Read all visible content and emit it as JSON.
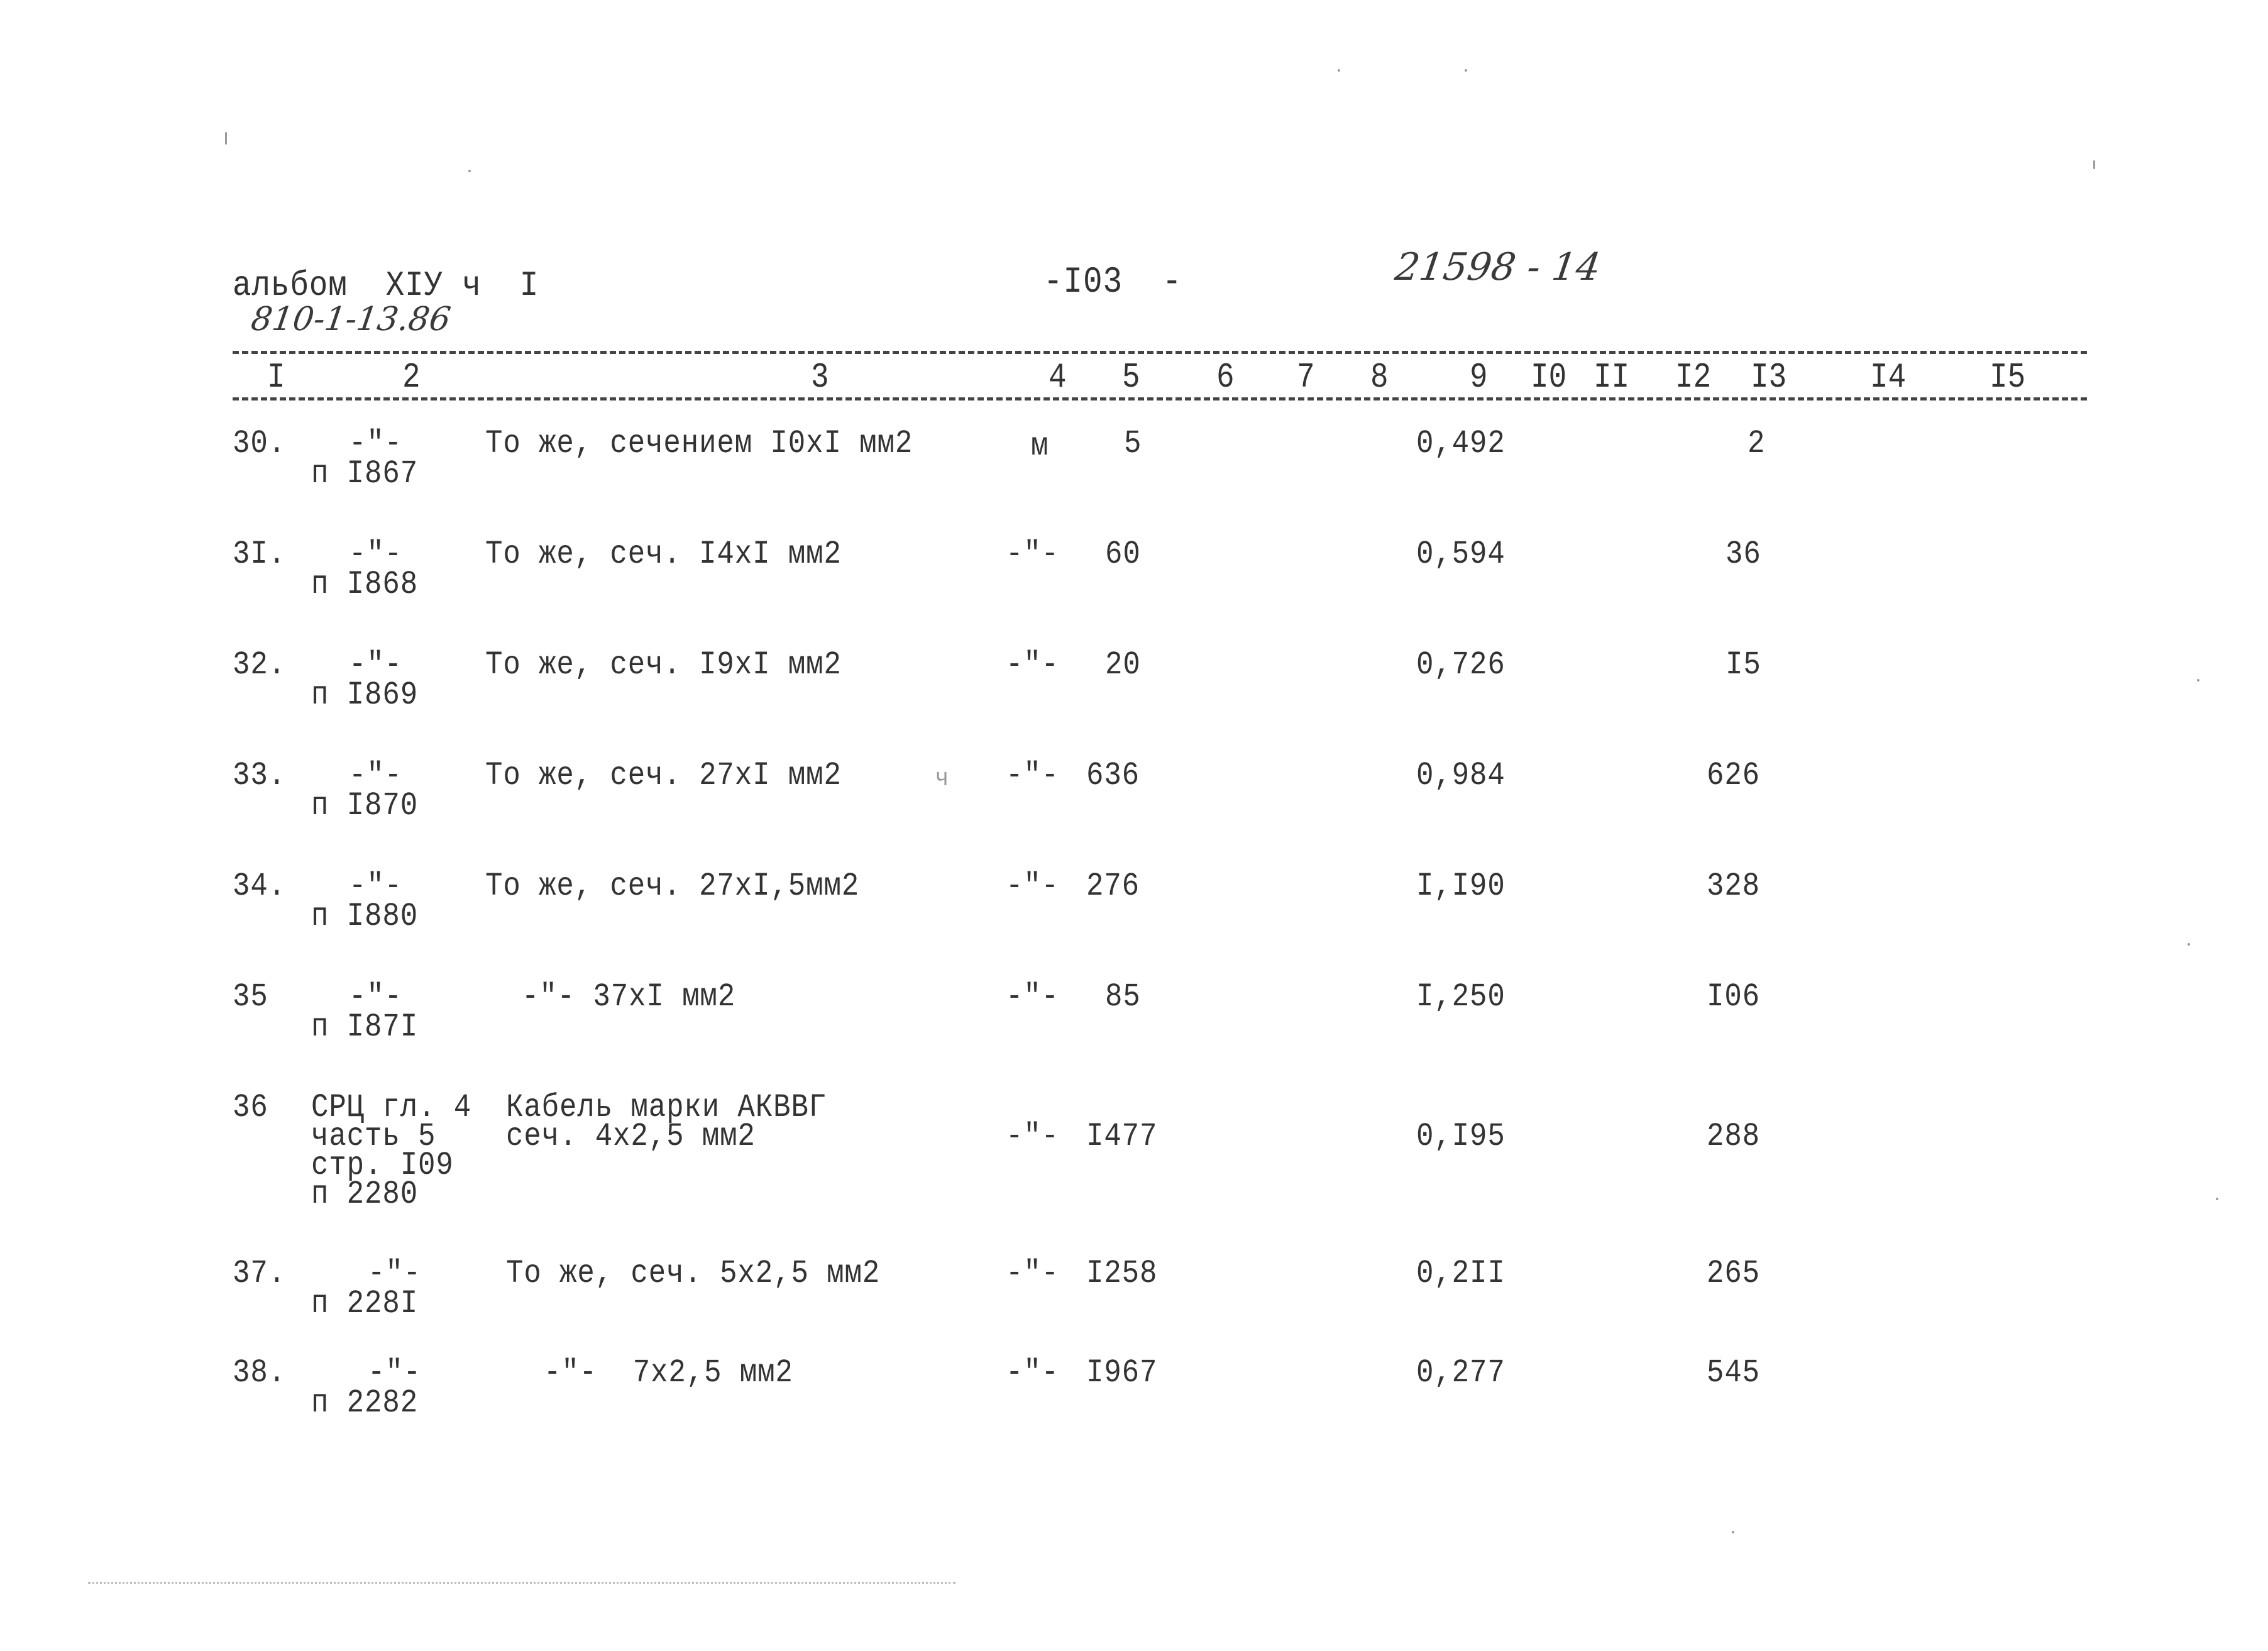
{
  "header": {
    "album": "альбом  XIУ ч  I",
    "handwritten_code": "810-1-13.86",
    "page_number": "-I03  -",
    "handwritten_doc_id": "21598 - 14"
  },
  "columns": [
    "I",
    "2",
    "3",
    "4",
    "5",
    "6",
    "7",
    "8",
    "9",
    "I0",
    "II",
    "I2",
    "I3",
    "I4",
    "I5"
  ],
  "rows": [
    {
      "num": "30.",
      "ref": "-\"-",
      "ref2": "п I867",
      "desc": "То же, сечением I0xI мм2",
      "unit": "м",
      "qty": "5",
      "price": "0,492",
      "total": "2"
    },
    {
      "num": "3I.",
      "ref": "-\"-",
      "ref2": "п I868",
      "desc": "То же, сеч. I4xI мм2",
      "unit": "-\"-",
      "qty": "60",
      "price": "0,594",
      "total": "36"
    },
    {
      "num": "32.",
      "ref": "-\"-",
      "ref2": "п I869",
      "desc": "То же, сеч. I9xI мм2",
      "unit": "-\"-",
      "qty": "20",
      "price": "0,726",
      "total": "I5"
    },
    {
      "num": "33.",
      "ref": "-\"-",
      "ref2": "п I870",
      "desc": "То же, сеч. 27xI мм2",
      "mark": "ч",
      "unit": "-\"-",
      "qty": "636",
      "price": "0,984",
      "total": "626"
    },
    {
      "num": "34.",
      "ref": "-\"-",
      "ref2": "п I880",
      "desc": "То же, сеч. 27xI,5мм2",
      "unit": "-\"-",
      "qty": "276",
      "price": "I,I90",
      "total": "328"
    },
    {
      "num": "35",
      "ref": "-\"-",
      "ref2": "п I87I",
      "desc": "-\"- 37xI мм2",
      "unit": "-\"-",
      "qty": "85",
      "price": "I,250",
      "total": "I06"
    },
    {
      "num": "36",
      "ref_lines": [
        "СРЦ гл. 4",
        "часть 5",
        "стр. I09",
        "п 2280"
      ],
      "desc_lines": [
        "Кабель марки АКВВГ",
        "сеч. 4x2,5 мм2"
      ],
      "unit": "-\"-",
      "qty": "I477",
      "price": "0,I95",
      "total": "288"
    },
    {
      "num": "37.",
      "ref": "-\"-",
      "ref2": "п 228I",
      "desc": "То же, сеч. 5x2,5 мм2",
      "unit": "-\"-",
      "qty": "I258",
      "price": "0,2II",
      "total": "265"
    },
    {
      "num": "38.",
      "ref": "-\"-",
      "ref2": "п 2282",
      "desc": "-\"-  7x2,5 мм2",
      "unit": "-\"-",
      "qty": "I967",
      "price": "0,277",
      "total": "545"
    }
  ]
}
